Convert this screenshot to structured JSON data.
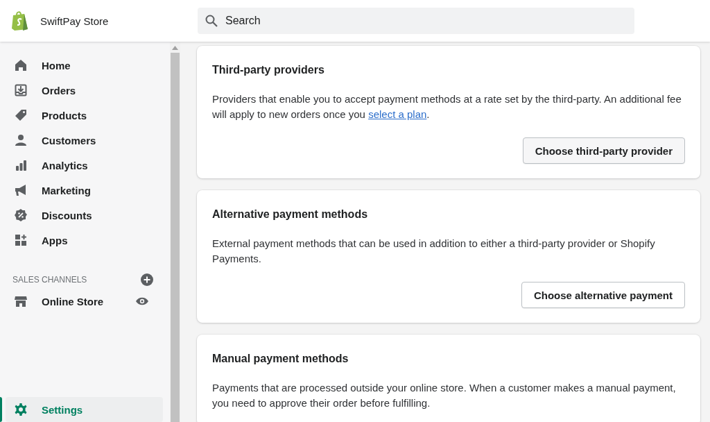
{
  "store": {
    "name": "SwiftPay Store"
  },
  "search": {
    "placeholder": "Search"
  },
  "sidebar": {
    "items": [
      {
        "label": "Home",
        "kind": "home",
        "selected": false
      },
      {
        "label": "Orders",
        "kind": "orders",
        "selected": false
      },
      {
        "label": "Products",
        "kind": "tag",
        "selected": false
      },
      {
        "label": "Customers",
        "kind": "person",
        "selected": false
      },
      {
        "label": "Analytics",
        "kind": "bars",
        "selected": false
      },
      {
        "label": "Marketing",
        "kind": "megaphone",
        "selected": false
      },
      {
        "label": "Discounts",
        "kind": "discount",
        "selected": false
      },
      {
        "label": "Apps",
        "kind": "apps",
        "selected": false
      }
    ],
    "sales_channels": {
      "heading": "SALES CHANNELS",
      "items": [
        {
          "label": "Online Store",
          "kind": "store",
          "selected": false
        }
      ]
    },
    "settings": {
      "label": "Settings",
      "kind": "gear",
      "selected": true
    }
  },
  "cards": [
    {
      "title": "Third-party providers",
      "description": "Providers that enable you to accept payment methods at a rate set by the third-party. An additional fee will apply to new orders once you ",
      "link": "select a plan",
      "description_end": ".",
      "button": "Choose third-party provider"
    },
    {
      "title": "Alternative payment methods",
      "description": "External payment methods that can be used in addition to either a third-party provider or Shopify Payments.",
      "button": "Choose alternative payment"
    },
    {
      "title": "Manual payment methods",
      "description": "Payments that are processed outside your online store. When a customer makes a manual payment, you need to approve their order before fulfilling."
    }
  ]
}
